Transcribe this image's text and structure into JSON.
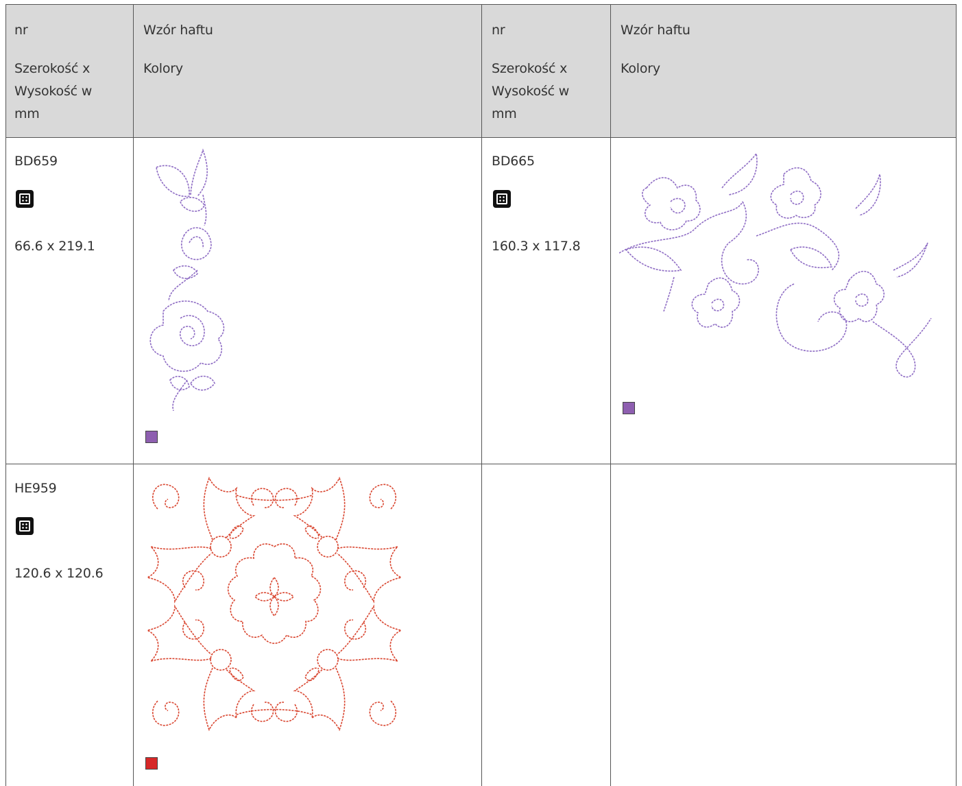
{
  "header": {
    "col1": {
      "nr": "nr",
      "size": "Szerokość x Wysokość w mm"
    },
    "col2": {
      "design": "Wzór haftu",
      "colors": "Kolory"
    },
    "col3": {
      "nr": "nr",
      "size": "Szerokość x Wysokość w mm"
    },
    "col4": {
      "design": "Wzór haftu",
      "colors": "Kolory"
    }
  },
  "rows": [
    {
      "left": {
        "nr": "BD659",
        "size": "66.6 x 219.1",
        "icon": "quilt-stitch-icon",
        "swatch": "#8e5fb0",
        "design": "floral-border-pattern"
      },
      "right": {
        "nr": "BD665",
        "size": "160.3 x 117.8",
        "icon": "quilt-stitch-icon",
        "swatch": "#8e5fb0",
        "design": "floral-vine-pattern"
      }
    },
    {
      "left": {
        "nr": "HE959",
        "size": "120.6 x 120.6",
        "icon": "quilt-stitch-icon",
        "swatch": "#d62828",
        "design": "ornamental-square-pattern"
      }
    }
  ],
  "colors": {
    "purple_stitch": "#8e6cc4",
    "red_stitch": "#d9452f",
    "header_bg": "#d9d9d9"
  }
}
